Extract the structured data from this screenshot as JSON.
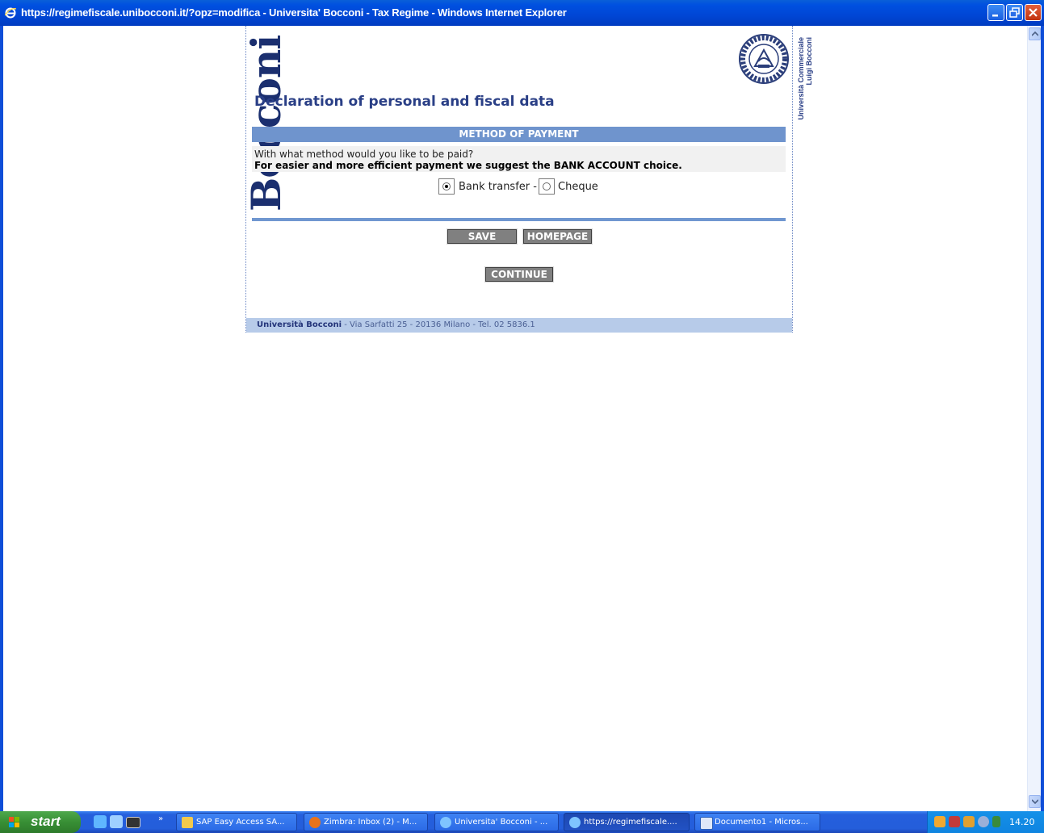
{
  "window": {
    "title": "https://regimefiscale.unibocconi.it/?opz=modifica - Universita' Bocconi - Tax Regime - Windows Internet Explorer",
    "icon": "ie-icon",
    "controls": [
      "minimize",
      "restore",
      "close"
    ]
  },
  "page": {
    "logo_text": "Bocconi",
    "side_text": [
      "Università Commerciale",
      "Luigi Bocconi"
    ],
    "heading": "Declaration of personal and fiscal data",
    "section_title": "METHOD OF PAYMENT",
    "question": "With what method would you like to be paid?",
    "suggestion": "For easier and more efficient payment we suggest the BANK ACCOUNT choice.",
    "payment_options": [
      {
        "label": "Bank transfer - ",
        "checked": true
      },
      {
        "label": "Cheque",
        "checked": false
      }
    ],
    "buttons": {
      "save": "SAVE",
      "homepage": "HOMEPAGE",
      "continue": "CONTINUE"
    },
    "footer": {
      "name": "Università Bocconi",
      "address": " - Via Sarfatti 25 - 20136 Milano - Tel. 02 5836.1"
    }
  },
  "taskbar": {
    "start_label": "start",
    "tasks": [
      {
        "label": "SAP Easy Access  SA...",
        "active": false,
        "icon": "sap-icon"
      },
      {
        "label": "Zimbra: Inbox (2) - M...",
        "active": false,
        "icon": "firefox-icon"
      },
      {
        "label": "Universita' Bocconi - ...",
        "active": false,
        "icon": "ie-icon"
      },
      {
        "label": "https://regimefiscale....",
        "active": true,
        "icon": "ie-icon"
      },
      {
        "label": "Documento1 - Micros...",
        "active": false,
        "icon": "word-icon"
      }
    ],
    "clock": "14.20"
  },
  "colors": {
    "title_bar": "#0046d5",
    "section_bar": "#6f94cd",
    "heading": "#2a3f86",
    "button": "#808080",
    "footer": "#b7cbe9"
  }
}
